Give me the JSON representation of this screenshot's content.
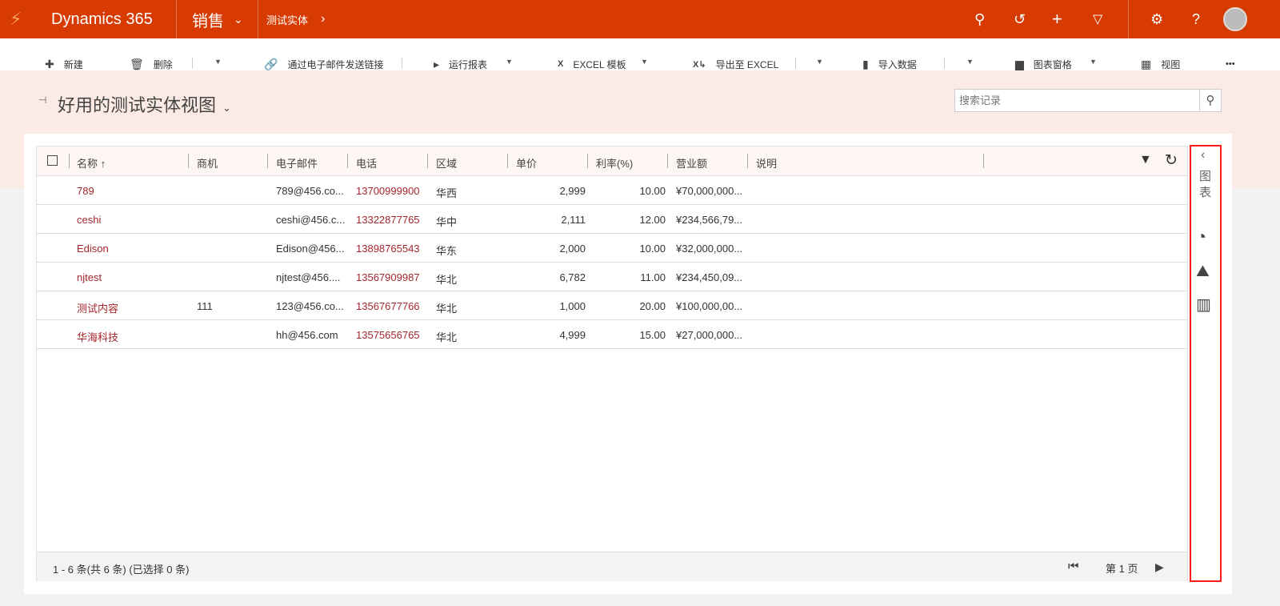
{
  "nav": {
    "app_name": "Dynamics 365",
    "module": "销售",
    "breadcrumb": "测试实体",
    "brand_color": "#D83B01"
  },
  "toolbar": {
    "new": "新建",
    "delete": "删除",
    "email_link": "通过电子邮件发送链接",
    "run_report": "运行报表",
    "excel_template": "EXCEL 模板",
    "export_excel": "导出至 EXCEL",
    "import_data": "导入数据",
    "chart_pane": "图表窗格",
    "view": "视图",
    "more": "•••"
  },
  "view": {
    "title": "好用的测试实体视图",
    "search_placeholder": "搜索记录"
  },
  "grid": {
    "columns": [
      "名称 ↑",
      "商机",
      "电子邮件",
      "电话",
      "区域",
      "单价",
      "利率(%)",
      "营业额",
      "说明"
    ],
    "rows": [
      [
        "789",
        "",
        "789@456.co...",
        "13700999900",
        "华西",
        "2,999",
        "10.00",
        "¥70,000,000...",
        ""
      ],
      [
        "ceshi",
        "",
        "ceshi@456.c...",
        "13322877765",
        "华中",
        "2,111",
        "12.00",
        "¥234,566,79...",
        ""
      ],
      [
        "Edison",
        "",
        "Edison@456...",
        "13898765543",
        "华东",
        "2,000",
        "10.00",
        "¥32,000,000...",
        ""
      ],
      [
        "njtest",
        "",
        "njtest@456....",
        "13567909987",
        "华北",
        "6,782",
        "11.00",
        "¥234,450,09...",
        ""
      ],
      [
        "测试内容",
        "111",
        "123@456.co...",
        "13567677766",
        "华北",
        "1,000",
        "20.00",
        "¥100,000,00...",
        ""
      ],
      [
        "华海科技",
        "",
        "hh@456.com",
        "13575656765",
        "华北",
        "4,999",
        "15.00",
        "¥27,000,000...",
        ""
      ]
    ],
    "status": "1 - 6  条(共 6 条) (已选择 0 条)",
    "page": "第 1 页"
  },
  "side_panel": {
    "label": "图表"
  }
}
